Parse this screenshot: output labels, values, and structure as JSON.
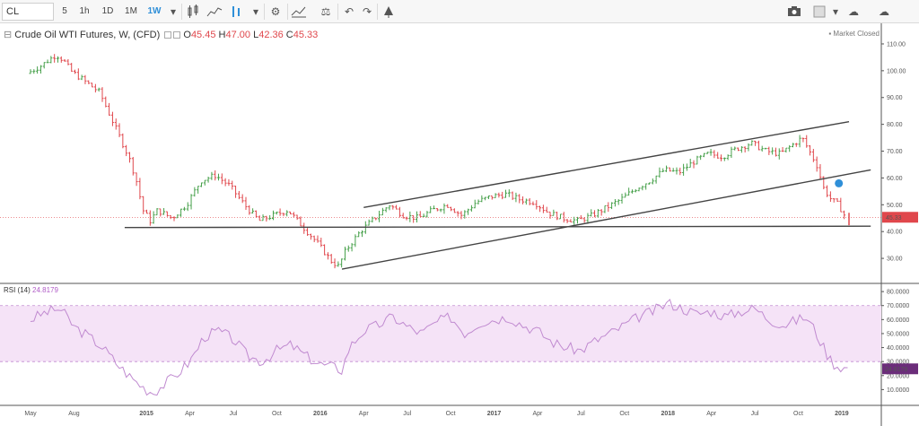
{
  "toolbar": {
    "symbol": "CL",
    "intervals": [
      "5",
      "1h",
      "1D",
      "1M",
      "1W"
    ],
    "active_interval": "1W",
    "icons": [
      "chevron-down-icon",
      "candles-icon",
      "area-icon",
      "bars-icon",
      "gear-icon",
      "indicators-icon",
      "compare-icon",
      "undo-icon",
      "redo-icon",
      "alert-icon",
      "camera-icon",
      "layout-icon",
      "cloud-icon",
      "cloud-save-icon"
    ]
  },
  "legend": {
    "title": "Crude Oil WTI Futures, W, (CFD)",
    "open_label": "O",
    "open": "45.45",
    "high_label": "H",
    "high": "47.00",
    "low_label": "L",
    "low": "42.36",
    "close_label": "C",
    "close": "45.33"
  },
  "status": "Market Closed",
  "rsi": {
    "label": "RSI (14)",
    "value": "24.8179"
  },
  "price_badge": "45.33",
  "colors": {
    "up": "#46a04a",
    "down": "#e0474c",
    "rsi": "#c08ad0",
    "rsi_band": "#f5e3f7",
    "trend": "#444444",
    "badge": "#e0474c",
    "rsi_badge": "#6b2d7a",
    "marker": "#2f8fd8"
  },
  "chart_data": [
    {
      "type": "candlestick",
      "title": "Crude Oil WTI Futures, W, (CFD)",
      "ylim": [
        22,
        113
      ],
      "y_ticks": [
        30,
        40,
        50,
        60,
        70,
        80,
        90,
        100,
        110
      ],
      "y_tick_labels": [
        "30.00",
        "40.00",
        "50.00",
        "60.00",
        "70.00",
        "80.00",
        "90.00",
        "100.00",
        "110.00"
      ],
      "x_ticks": [
        {
          "t": 0.0,
          "label": "May"
        },
        {
          "t": 3.0,
          "label": "Aug"
        },
        {
          "t": 8.0,
          "label": "2015"
        },
        {
          "t": 11.0,
          "label": "Apr"
        },
        {
          "t": 14.0,
          "label": "Jul"
        },
        {
          "t": 17.0,
          "label": "Oct"
        },
        {
          "t": 20.0,
          "label": "2016"
        },
        {
          "t": 23.0,
          "label": "Apr"
        },
        {
          "t": 26.0,
          "label": "Jul"
        },
        {
          "t": 29.0,
          "label": "Oct"
        },
        {
          "t": 32.0,
          "label": "2017"
        },
        {
          "t": 35.0,
          "label": "Apr"
        },
        {
          "t": 38.0,
          "label": "Jul"
        },
        {
          "t": 41.0,
          "label": "Oct"
        },
        {
          "t": 44.0,
          "label": "2018"
        },
        {
          "t": 47.0,
          "label": "Apr"
        },
        {
          "t": 50.0,
          "label": "Jul"
        },
        {
          "t": 53.0,
          "label": "Oct"
        },
        {
          "t": 56.0,
          "label": "2019"
        }
      ],
      "xlim": [
        0.0,
        56.5
      ],
      "price_path": [
        [
          0.0,
          99
        ],
        [
          1.0,
          102
        ],
        [
          2.0,
          106
        ],
        [
          2.5,
          104
        ],
        [
          3.0,
          100
        ],
        [
          4.0,
          96
        ],
        [
          5.0,
          92
        ],
        [
          6.0,
          80
        ],
        [
          7.0,
          68
        ],
        [
          7.5,
          60
        ],
        [
          8.0,
          48
        ],
        [
          8.5,
          44
        ],
        [
          9.0,
          48
        ],
        [
          10.0,
          45
        ],
        [
          11.0,
          50
        ],
        [
          12.0,
          59
        ],
        [
          13.0,
          61
        ],
        [
          14.0,
          57
        ],
        [
          15.0,
          50
        ],
        [
          16.0,
          44
        ],
        [
          17.0,
          46
        ],
        [
          18.0,
          48
        ],
        [
          19.0,
          42
        ],
        [
          20.0,
          36
        ],
        [
          21.0,
          29
        ],
        [
          21.5,
          27
        ],
        [
          22.0,
          33
        ],
        [
          23.0,
          40
        ],
        [
          24.0,
          45
        ],
        [
          25.0,
          50
        ],
        [
          26.0,
          46
        ],
        [
          27.0,
          45
        ],
        [
          28.0,
          48
        ],
        [
          29.0,
          50
        ],
        [
          30.0,
          46
        ],
        [
          31.0,
          51
        ],
        [
          32.0,
          53
        ],
        [
          33.0,
          54
        ],
        [
          34.0,
          52
        ],
        [
          35.0,
          51
        ],
        [
          36.0,
          47
        ],
        [
          37.0,
          45
        ],
        [
          38.0,
          44
        ],
        [
          39.0,
          46
        ],
        [
          40.0,
          49
        ],
        [
          41.0,
          52
        ],
        [
          42.0,
          56
        ],
        [
          43.0,
          59
        ],
        [
          44.0,
          63
        ],
        [
          45.0,
          62
        ],
        [
          46.0,
          66
        ],
        [
          47.0,
          69
        ],
        [
          48.0,
          68
        ],
        [
          49.0,
          71
        ],
        [
          50.0,
          73
        ],
        [
          51.0,
          70
        ],
        [
          52.0,
          69
        ],
        [
          53.0,
          73
        ],
        [
          53.5,
          75
        ],
        [
          54.0,
          70
        ],
        [
          54.5,
          65
        ],
        [
          55.0,
          56
        ],
        [
          55.5,
          52
        ],
        [
          56.0,
          50
        ],
        [
          56.5,
          45.33
        ]
      ],
      "last": {
        "open": 45.45,
        "high": 47.0,
        "low": 42.36,
        "close": 45.33
      },
      "trendlines": [
        {
          "from": [
            6.5,
            41.5
          ],
          "to": [
            58.0,
            42.0
          ]
        },
        {
          "from": [
            21.5,
            26.0
          ],
          "to": [
            58.0,
            63.0
          ]
        },
        {
          "from": [
            23.0,
            49.0
          ],
          "to": [
            56.5,
            81.0
          ]
        }
      ]
    },
    {
      "type": "line",
      "title": "RSI (14)",
      "ylim": [
        0,
        82
      ],
      "y_ticks": [
        10,
        20,
        30,
        40,
        50,
        60,
        70,
        80
      ],
      "y_tick_labels": [
        "10.0000",
        "20.0000",
        "30.0000",
        "40.0000",
        "50.0000",
        "60.0000",
        "70.0000",
        "80.0000"
      ],
      "band": [
        30,
        70
      ],
      "x": [
        0.0,
        1.0,
        2.0,
        2.5,
        3.0,
        4.0,
        5.0,
        6.0,
        7.0,
        7.5,
        8.0,
        8.5,
        9.0,
        10.0,
        11.0,
        12.0,
        13.0,
        14.0,
        15.0,
        16.0,
        17.0,
        18.0,
        19.0,
        20.0,
        21.0,
        21.5,
        22.0,
        23.0,
        24.0,
        25.0,
        26.0,
        27.0,
        28.0,
        29.0,
        30.0,
        31.0,
        32.0,
        33.0,
        34.0,
        35.0,
        36.0,
        37.0,
        38.0,
        39.0,
        40.0,
        41.0,
        42.0,
        43.0,
        44.0,
        45.0,
        46.0,
        47.0,
        48.0,
        49.0,
        50.0,
        51.0,
        52.0,
        53.0,
        53.5,
        54.0,
        54.5,
        55.0,
        55.5,
        56.0,
        56.5
      ],
      "y": [
        60,
        65,
        68,
        62,
        55,
        48,
        40,
        28,
        18,
        14,
        10,
        8,
        12,
        20,
        30,
        48,
        52,
        46,
        34,
        30,
        38,
        42,
        34,
        28,
        26,
        24,
        40,
        52,
        56,
        62,
        55,
        50,
        58,
        62,
        50,
        58,
        60,
        62,
        56,
        52,
        44,
        40,
        38,
        45,
        50,
        56,
        62,
        66,
        72,
        68,
        64,
        66,
        62,
        66,
        68,
        60,
        56,
        60,
        62,
        55,
        45,
        35,
        28,
        26,
        24.8
      ]
    }
  ]
}
